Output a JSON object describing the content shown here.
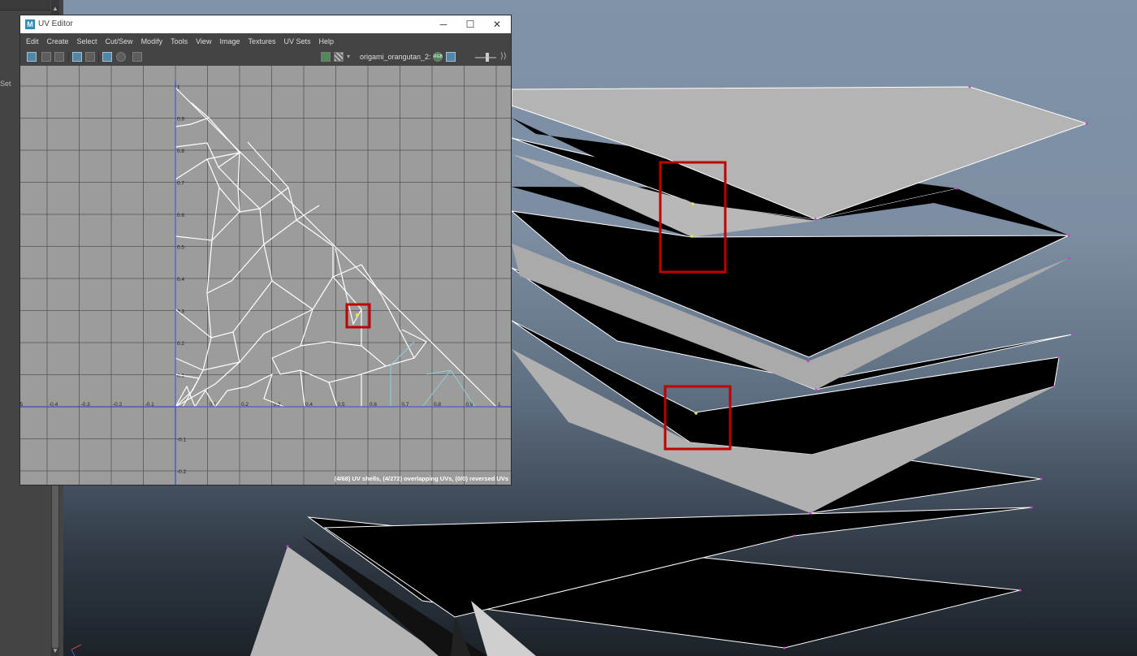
{
  "left_panel": {
    "label": "Set"
  },
  "uv_editor": {
    "title": "UV Editor",
    "app_icon_letter": "M",
    "window_controls": {
      "minimize": "─",
      "maximize": "☐",
      "close": "✕"
    },
    "menus": [
      "Edit",
      "Create",
      "Select",
      "Cut/Sew",
      "Modify",
      "Tools",
      "View",
      "Image",
      "Textures",
      "UV Sets",
      "Help"
    ],
    "toolbar": {
      "left_tools": [
        "grid-display-icon",
        "shaded-uv-icon",
        "texture-borders-icon",
        "isolate-select-icon",
        "dim-image-icon",
        "grid-snap-icon",
        "filter-icon",
        "snapshot-icon"
      ],
      "right_tools": [
        "image-display-icon",
        "checker-icon"
      ],
      "uv_set_name": "origami_orangutan_2:",
      "rgb_label": "RGB"
    },
    "axis": {
      "x_ticks": [
        "-.5",
        "-0.4",
        "-0.3",
        "-0.2",
        "-0.1",
        "0.1",
        "0.2",
        "0.3",
        "0.4",
        "0.5",
        "0.6",
        "0.7",
        "0.8",
        "0.9",
        "1"
      ],
      "y_ticks": [
        "1",
        "0.9",
        "0.8",
        "0.7",
        "0.6",
        "0.5",
        "0.4",
        "0.3",
        "0.2",
        "0.1",
        "-0.1",
        "-0.2"
      ]
    },
    "status": "(4/68) UV shells, (4/272) overlapping UVs, (0/0) reversed UVs"
  },
  "colors": {
    "highlight_box": "#c00000",
    "uv_wire": "#ffffff",
    "uv_selected_wire": "#8fd0e0",
    "axis_blue": "#3b4cc0",
    "canvas_bg": "#9c9c9c"
  }
}
